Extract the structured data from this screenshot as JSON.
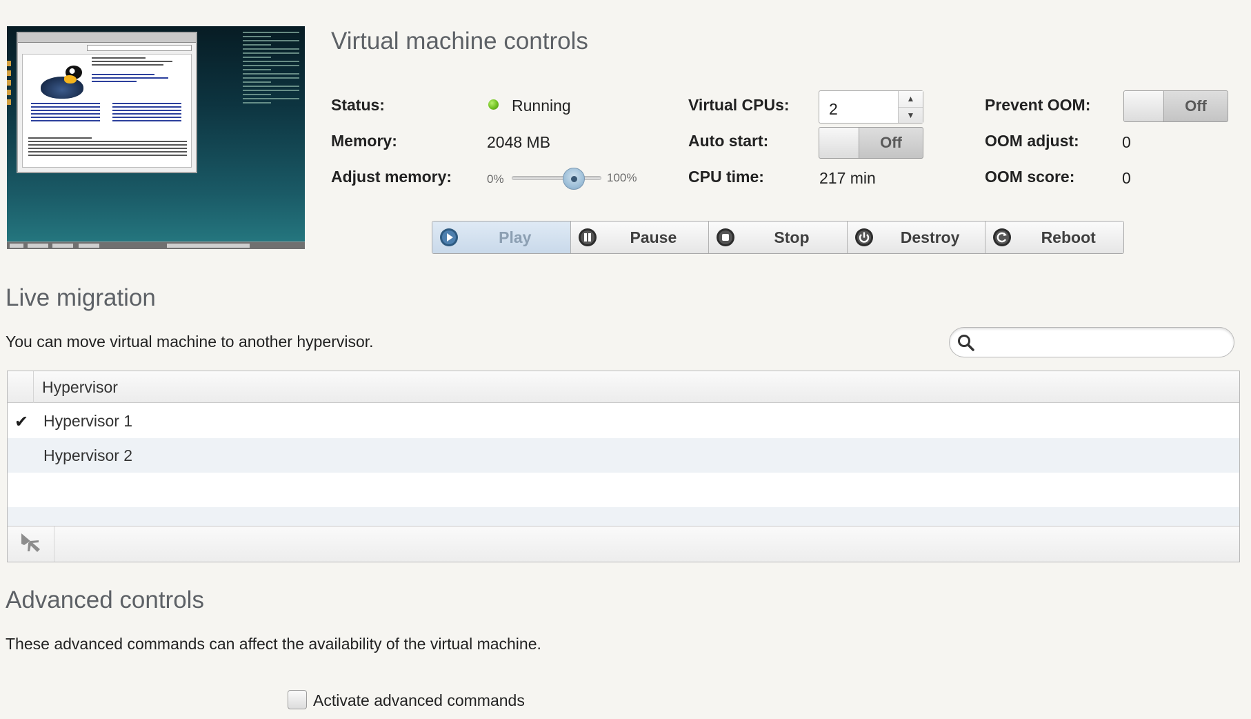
{
  "vm_controls": {
    "title": "Virtual machine controls",
    "status_label": "Status:",
    "status_value": "Running",
    "memory_label": "Memory:",
    "memory_value": "2048 MB",
    "adjust_memory_label": "Adjust memory:",
    "slider_min": "0%",
    "slider_max": "100%",
    "slider_value": 0.5,
    "vcpus_label": "Virtual CPUs:",
    "vcpus_value": "2",
    "auto_start_label": "Auto start:",
    "auto_start_value": "Off",
    "cpu_time_label": "CPU time:",
    "cpu_time_value": "217 min",
    "prevent_oom_label": "Prevent OOM:",
    "prevent_oom_value": "Off",
    "oom_adjust_label": "OOM adjust:",
    "oom_adjust_value": "0",
    "oom_score_label": "OOM score:",
    "oom_score_value": "0"
  },
  "actions": [
    {
      "label": "Play",
      "icon": "play-icon",
      "active": true
    },
    {
      "label": "Pause",
      "icon": "pause-icon"
    },
    {
      "label": "Stop",
      "icon": "stop-icon"
    },
    {
      "label": "Destroy",
      "icon": "power-icon"
    },
    {
      "label": "Reboot",
      "icon": "reboot-icon"
    }
  ],
  "live_migration": {
    "title": "Live migration",
    "description": "You can move virtual machine to another hypervisor.",
    "search_placeholder": "",
    "column_header": "Hypervisor",
    "rows": [
      {
        "name": "Hypervisor 1",
        "selected": true
      },
      {
        "name": "Hypervisor 2",
        "selected": false
      }
    ],
    "footer_icon": "migrate-plane-icon"
  },
  "advanced": {
    "title": "Advanced controls",
    "description": "These advanced commands can affect the availability of the virtual machine.",
    "checkbox_label": "Activate advanced commands",
    "checkbox_checked": false
  },
  "colors": {
    "status_running": "#6fbf1f",
    "accent_blue": "#2e5a80"
  }
}
